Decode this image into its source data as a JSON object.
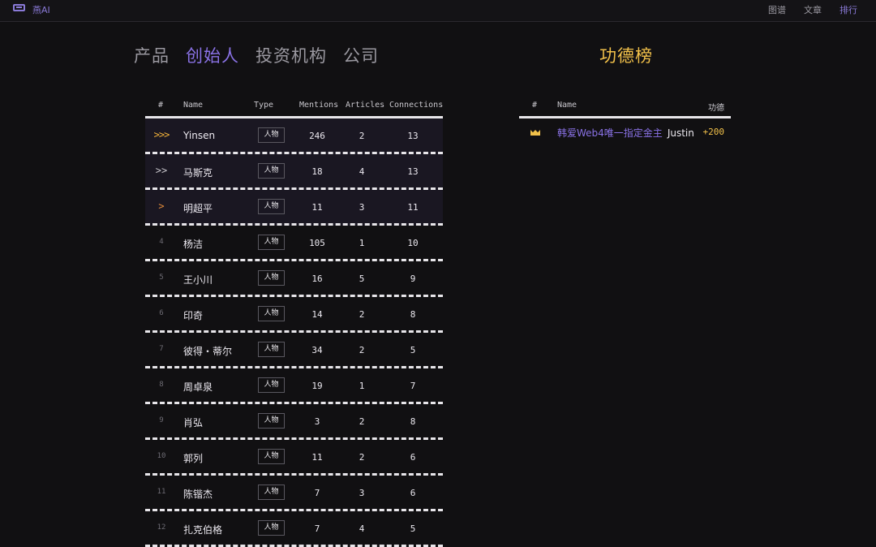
{
  "topbar": {
    "logo_text": "燕AI",
    "nav": [
      "图谱",
      "文章",
      "排行"
    ]
  },
  "tabs": [
    "产品",
    "创始人",
    "投资机构",
    "公司"
  ],
  "active_tab": 1,
  "ranking": {
    "headers": {
      "rank": "#",
      "name": "Name",
      "type": "Type",
      "mentions": "Mentions",
      "articles": "Articles",
      "connections": "Connections"
    },
    "rows": [
      {
        "rank": ">>>",
        "name": "Yinsen",
        "type": "人物",
        "mentions": "246",
        "articles": "2",
        "connections": "13"
      },
      {
        "rank": ">>",
        "name": "马斯克",
        "type": "人物",
        "mentions": "18",
        "articles": "4",
        "connections": "13"
      },
      {
        "rank": ">",
        "name": "明超平",
        "type": "人物",
        "mentions": "11",
        "articles": "3",
        "connections": "11"
      },
      {
        "rank": "4",
        "name": "杨洁",
        "type": "人物",
        "mentions": "105",
        "articles": "1",
        "connections": "10"
      },
      {
        "rank": "5",
        "name": "王小川",
        "type": "人物",
        "mentions": "16",
        "articles": "5",
        "connections": "9"
      },
      {
        "rank": "6",
        "name": "印奇",
        "type": "人物",
        "mentions": "14",
        "articles": "2",
        "connections": "8"
      },
      {
        "rank": "7",
        "name": "彼得・蒂尔",
        "type": "人物",
        "mentions": "34",
        "articles": "2",
        "connections": "5"
      },
      {
        "rank": "8",
        "name": "周卓泉",
        "type": "人物",
        "mentions": "19",
        "articles": "1",
        "connections": "7"
      },
      {
        "rank": "9",
        "name": "肖弘",
        "type": "人物",
        "mentions": "3",
        "articles": "2",
        "connections": "8"
      },
      {
        "rank": "10",
        "name": "郭列",
        "type": "人物",
        "mentions": "11",
        "articles": "2",
        "connections": "6"
      },
      {
        "rank": "11",
        "name": "陈锴杰",
        "type": "人物",
        "mentions": "7",
        "articles": "3",
        "connections": "6"
      },
      {
        "rank": "12",
        "name": "扎克伯格",
        "type": "人物",
        "mentions": "7",
        "articles": "4",
        "connections": "5"
      }
    ]
  },
  "merit": {
    "title": "功德榜",
    "headers": {
      "rank": "#",
      "name": "Name",
      "score": "功德"
    },
    "rows": [
      {
        "icon": "crown-icon",
        "name": "韩爱Web4唯一指定金主",
        "user": "Justin",
        "score": "+200"
      }
    ]
  },
  "colors": {
    "accent": "#8a72e6",
    "gold": "#f2c14a",
    "background": "#111012"
  }
}
